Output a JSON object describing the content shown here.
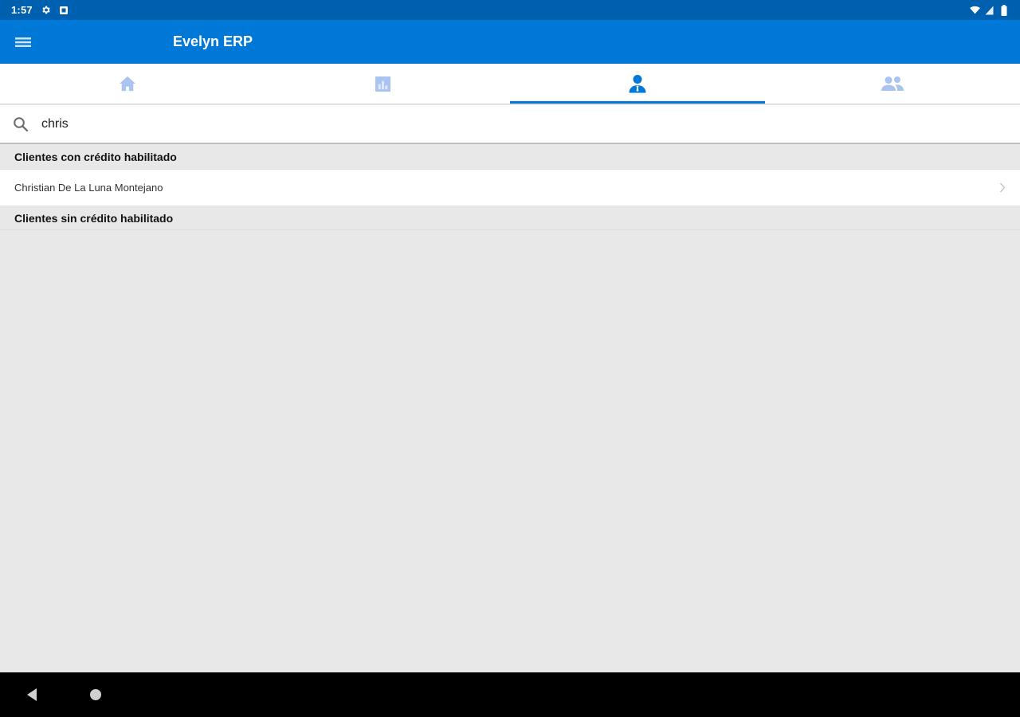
{
  "status_bar": {
    "time": "1:57",
    "icons": [
      "gear-icon",
      "sim-card-icon",
      "wifi-icon",
      "signal-icon",
      "battery-icon"
    ]
  },
  "app_bar": {
    "title": "Evelyn ERP",
    "background": "#0078d7"
  },
  "tabs": [
    {
      "icon": "home-icon",
      "selected": false
    },
    {
      "icon": "chart-icon",
      "selected": false
    },
    {
      "icon": "person-icon",
      "selected": true
    },
    {
      "icon": "people-icon",
      "selected": false
    }
  ],
  "search": {
    "value": "chris"
  },
  "sections": [
    {
      "title": "Clientes con crédito habilitado",
      "items": [
        {
          "label": "Christian De La Luna Montejano"
        }
      ]
    },
    {
      "title": "Clientes sin crédito habilitado",
      "items": []
    }
  ],
  "colors": {
    "accent": "#0078d7",
    "status_bar": "#0060b0",
    "inactive_tab_icon": "#a9c4f0",
    "background": "#e8e8e8"
  }
}
